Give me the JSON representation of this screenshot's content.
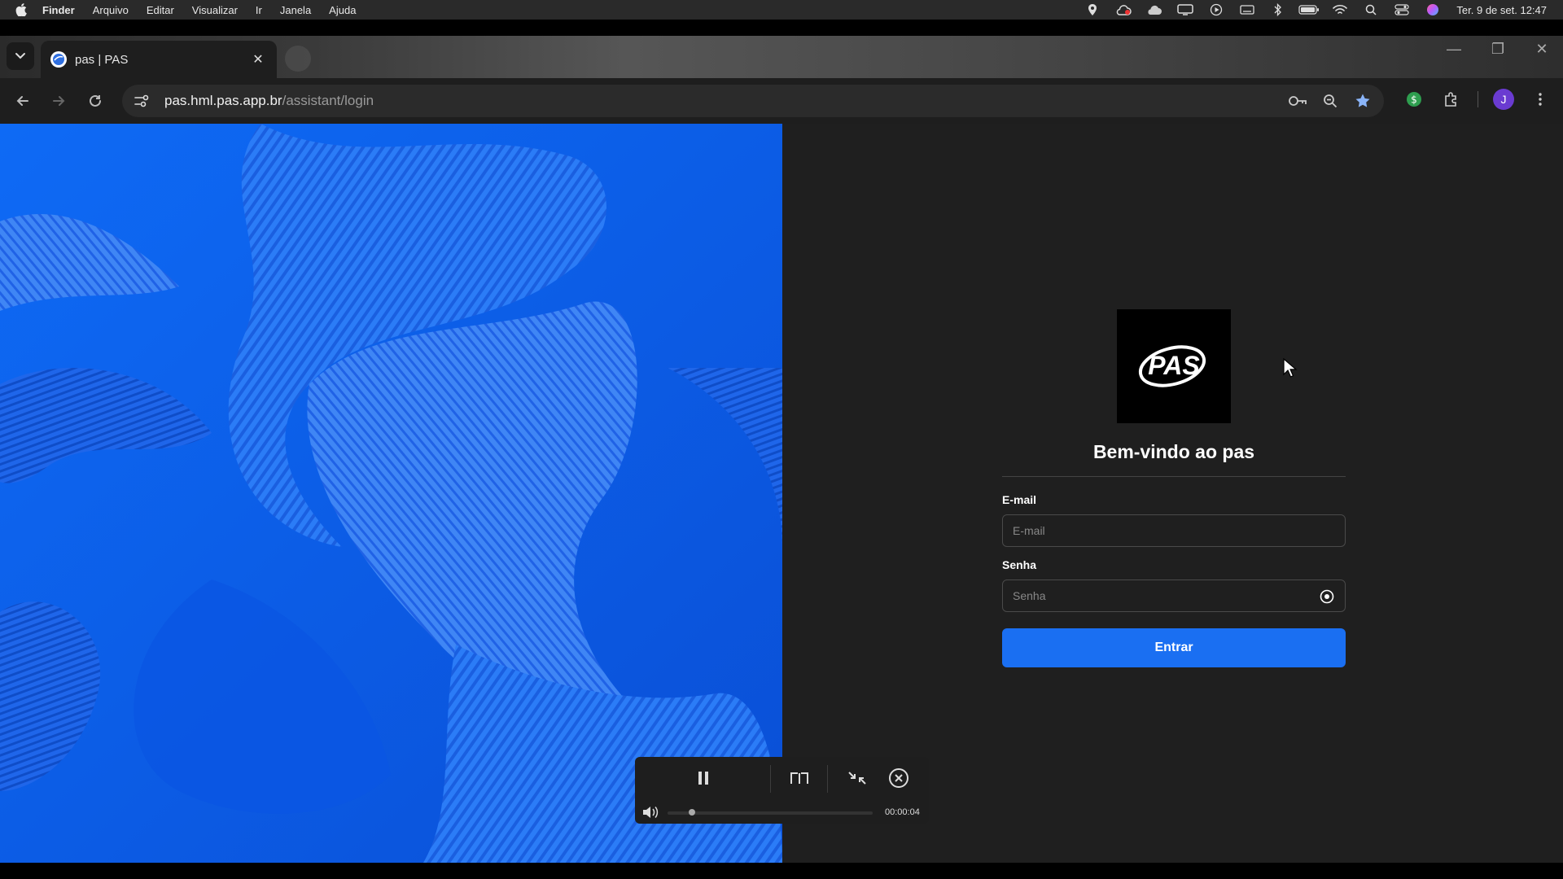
{
  "menubar": {
    "app_name": "Finder",
    "items": [
      "Arquivo",
      "Editar",
      "Visualizar",
      "Ir",
      "Janela",
      "Ajuda"
    ],
    "clock": "Ter. 9 de set. 12:47",
    "tray_icons": [
      "location-icon",
      "cloud-sync-icon",
      "cloud-icon",
      "display-icon",
      "play-icon",
      "keyboard-icon",
      "bluetooth-icon",
      "battery-icon",
      "wifi-icon",
      "search-icon",
      "control-center-icon",
      "siri-icon"
    ]
  },
  "browser": {
    "tab": {
      "title": "pas | PAS"
    },
    "url_host": "pas.hml.pas.app.br",
    "url_path": "/assistant/login",
    "profile_initial": "J"
  },
  "login": {
    "logo_text": "PAS",
    "welcome": "Bem-vindo ao pas",
    "email_label": "E-mail",
    "email_placeholder": "E-mail",
    "password_label": "Senha",
    "password_placeholder": "Senha",
    "submit_label": "Entrar"
  },
  "media_player": {
    "time": "00:00:04",
    "progress": 0.12
  },
  "colors": {
    "accent": "#1a6ff2",
    "hero_blue": "#0a5ff0",
    "page_bg": "#1f1f1f"
  }
}
